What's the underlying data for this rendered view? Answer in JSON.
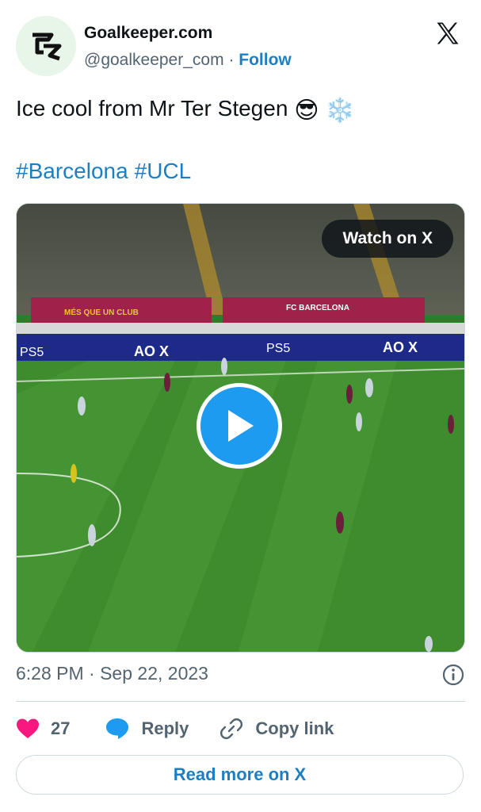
{
  "author": {
    "name": "Goalkeeper.com",
    "handle": "@goalkeeper_com",
    "separator": "·",
    "follow_label": "Follow",
    "avatar_icon": "goalkeeper-logo-icon"
  },
  "platform_icon": "x-logo-icon",
  "tweet": {
    "text": "Ice cool from Mr Ter Stegen",
    "emoji_1": "😎",
    "emoji_2": "❄️",
    "hashtags": [
      "#Barcelona",
      "#UCL"
    ]
  },
  "media": {
    "watch_label": "Watch on X",
    "play_icon": "play-icon",
    "banner_texts": [
      "MÉS QUE UN CLUB",
      "FC BARCELONA",
      "PS5",
      "AO X"
    ]
  },
  "meta": {
    "timestamp": "6:28 PM · Sep 22, 2023",
    "info_icon": "info-icon"
  },
  "actions": {
    "like_count": "27",
    "reply_label": "Reply",
    "copy_label": "Copy link"
  },
  "read_more_label": "Read more on X",
  "colors": {
    "link": "#1d7ec2",
    "play": "#1d9bf0",
    "like": "#f91880",
    "muted": "#536471"
  }
}
